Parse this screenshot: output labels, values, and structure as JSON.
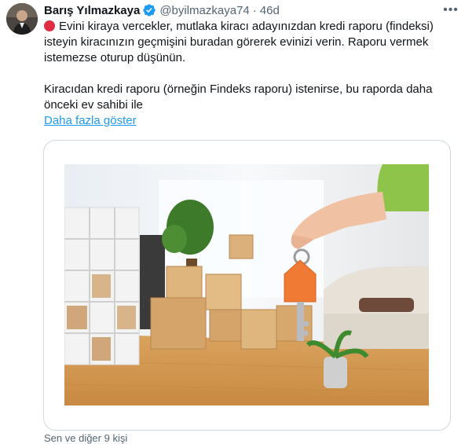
{
  "tweet": {
    "author": {
      "display_name": "Barış Yılmazkaya",
      "handle": "@byilmazkaya74",
      "verified": true,
      "avatar_icon": "profile-avatar"
    },
    "separator": "·",
    "timestamp": "46d",
    "more_icon": "more-dots-icon",
    "text": {
      "paragraph1": "Evini kiraya vercekler, mutlaka kiracı adayınızdan kredi raporu (findeksi) isteyin kiracınızın geçmişini buradan görerek evinizi verin. Raporu vermek istemezse oturup düşünün.",
      "paragraph2": "Kiracıdan kredi raporu (örneğin Findeks raporu) istenirse, bu raporda daha önceki ev sahibi ile",
      "show_more": "Daha fazla göster"
    },
    "media": {
      "description_icon": "house-key-photo"
    },
    "footer_partial": "Sen ve diğer 9 kişi"
  },
  "colors": {
    "link": "#1d9bf0",
    "verified": "#1d9bf0",
    "text": "#0f1419",
    "muted": "#536471",
    "emoji_red": "#dd2e44"
  }
}
